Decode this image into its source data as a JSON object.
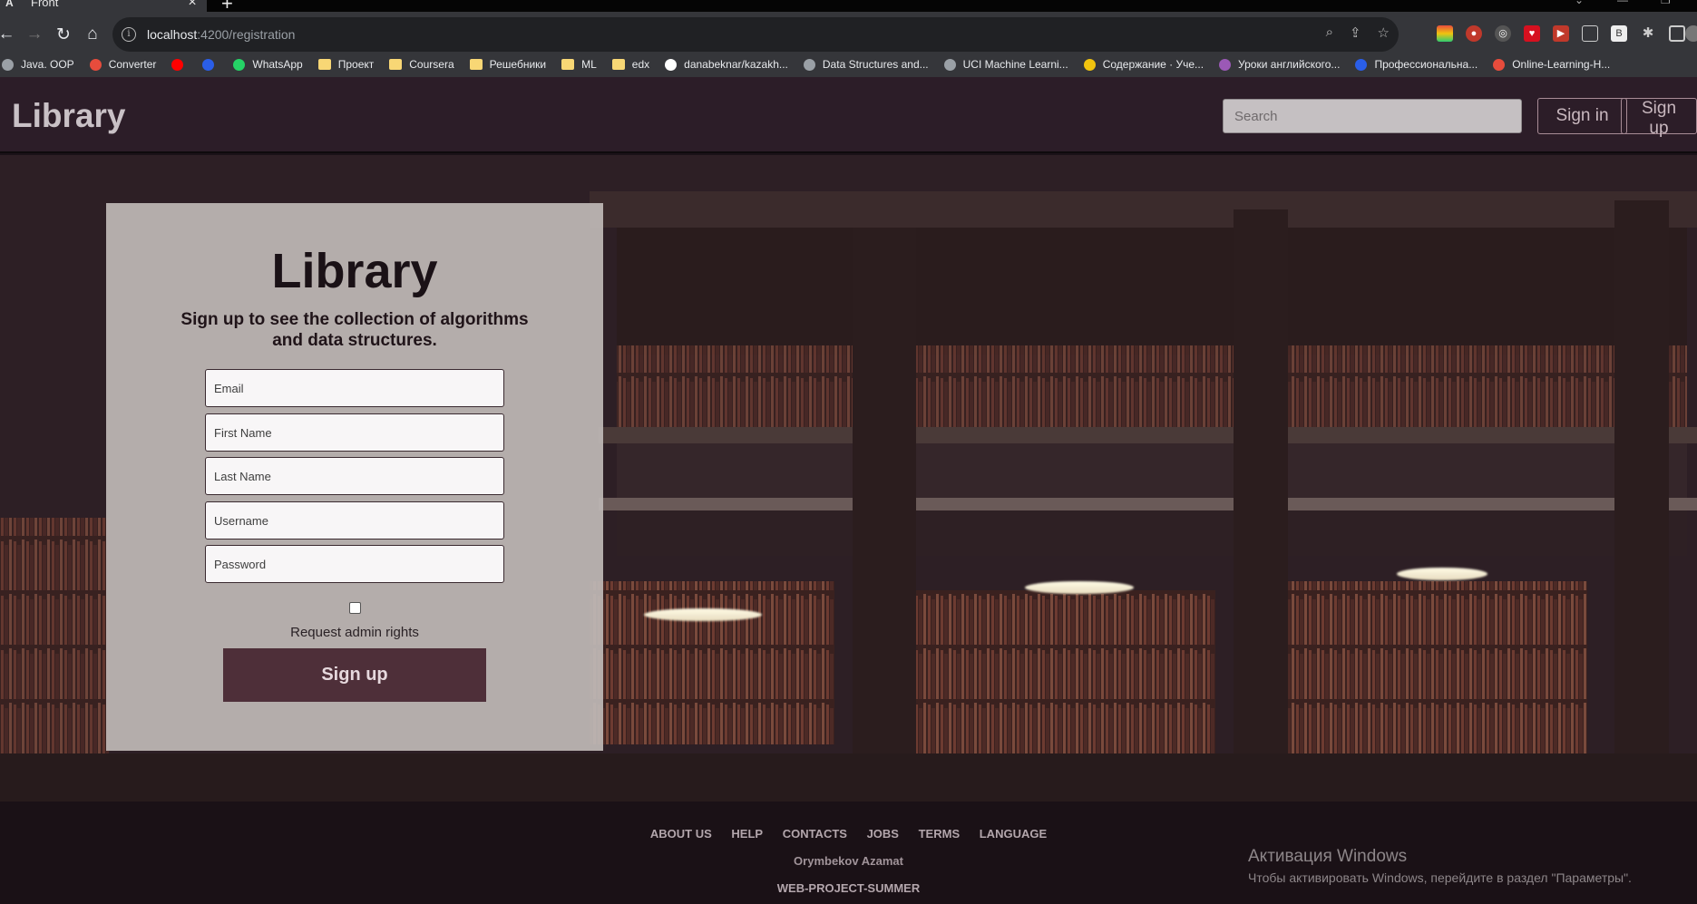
{
  "browser": {
    "tab_title": "Front",
    "tab_favicon": "A",
    "url_host": "localhost",
    "url_path": ":4200/registration"
  },
  "bookmarks": [
    {
      "label": "Java. OOP",
      "icon": "globe-icon",
      "color": "#9aa0a6"
    },
    {
      "label": "Converter",
      "icon": "converter-icon",
      "color": "#e74c3c"
    },
    {
      "label": "",
      "icon": "youtube-icon",
      "color": "#ff0000"
    },
    {
      "label": "",
      "icon": "vk-icon",
      "color": "#2a5ee8"
    },
    {
      "label": "WhatsApp",
      "icon": "whatsapp-icon",
      "color": "#25d366"
    },
    {
      "label": "Проект",
      "icon": "folder-icon",
      "color": "#f8d775"
    },
    {
      "label": "Coursera",
      "icon": "folder-icon",
      "color": "#f8d775"
    },
    {
      "label": "Решебники",
      "icon": "folder-icon",
      "color": "#f8d775"
    },
    {
      "label": "ML",
      "icon": "folder-icon",
      "color": "#f8d775"
    },
    {
      "label": "edx",
      "icon": "folder-icon",
      "color": "#f8d775"
    },
    {
      "label": "danabeknar/kazakh...",
      "icon": "github-icon",
      "color": "#ffffff"
    },
    {
      "label": "Data Structures and...",
      "icon": "globe-icon",
      "color": "#9aa0a6"
    },
    {
      "label": "UCI Machine Learni...",
      "icon": "globe-icon",
      "color": "#9aa0a6"
    },
    {
      "label": "Содержание · Уче...",
      "icon": "book-icon",
      "color": "#f1c40f"
    },
    {
      "label": "Уроки английского...",
      "icon": "flower-icon",
      "color": "#9b59b6"
    },
    {
      "label": "Профессиональна...",
      "icon": "c-icon",
      "color": "#2a5ee8"
    },
    {
      "label": "Online-Learning-H...",
      "icon": "huawei-icon",
      "color": "#e74c3c"
    }
  ],
  "header": {
    "brand": "Library",
    "search_placeholder": "Search",
    "signin_label": "Sign in",
    "signup_label": "Sign up"
  },
  "form": {
    "title": "Library",
    "subtitle": "Sign up to see the collection of algorithms and data structures.",
    "fields": {
      "email": "Email",
      "first_name": "First Name",
      "last_name": "Last Name",
      "username": "Username",
      "password": "Password"
    },
    "admin_label": "Request admin rights",
    "submit_label": "Sign up"
  },
  "footer": {
    "links": [
      "ABOUT US",
      "HELP",
      "CONTACTS",
      "JOBS",
      "TERMS",
      "LANGUAGE"
    ],
    "author": "Orymbekov Azamat",
    "project": "WEB-PROJECT-SUMMER"
  },
  "watermark": {
    "title": "Активация Windows",
    "subtitle": "Чтобы активировать Windows, перейдите в раздел \"Параметры\"."
  },
  "colors": {
    "header_bg": "#2c1d28",
    "button_bg": "#4e2f39",
    "footer_bg": "#1a1116"
  }
}
